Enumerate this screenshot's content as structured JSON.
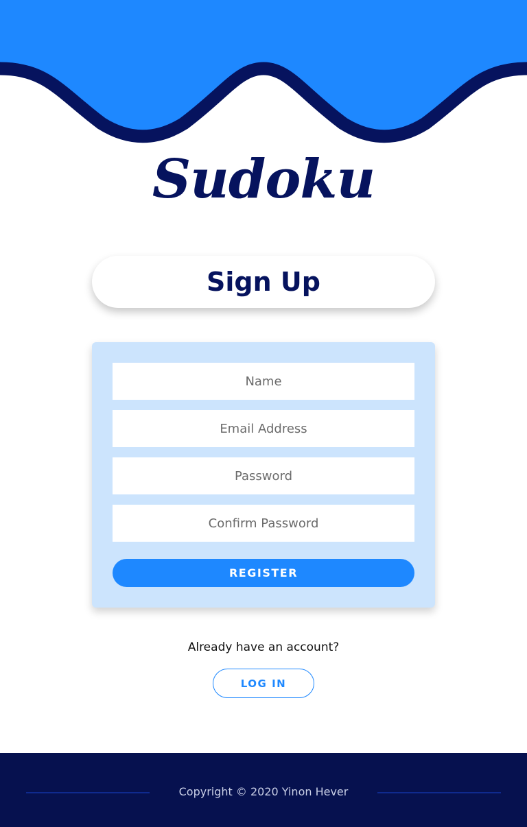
{
  "header": {
    "logo_text": "Sudoku"
  },
  "page": {
    "title": "Sign Up"
  },
  "form": {
    "name_placeholder": "Name",
    "email_placeholder": "Email Address",
    "password_placeholder": "Password",
    "confirm_password_placeholder": "Confirm Password",
    "register_label": "REGISTER"
  },
  "login": {
    "prompt": "Already have an account?",
    "button_label": "LOG IN"
  },
  "footer": {
    "copyright": "Copyright © 2020 Yinon Hever"
  },
  "colors": {
    "primary_blue": "#1e88ff",
    "navy": "#06135e",
    "form_background": "#cce4fd",
    "footer_background": "#06114f"
  }
}
